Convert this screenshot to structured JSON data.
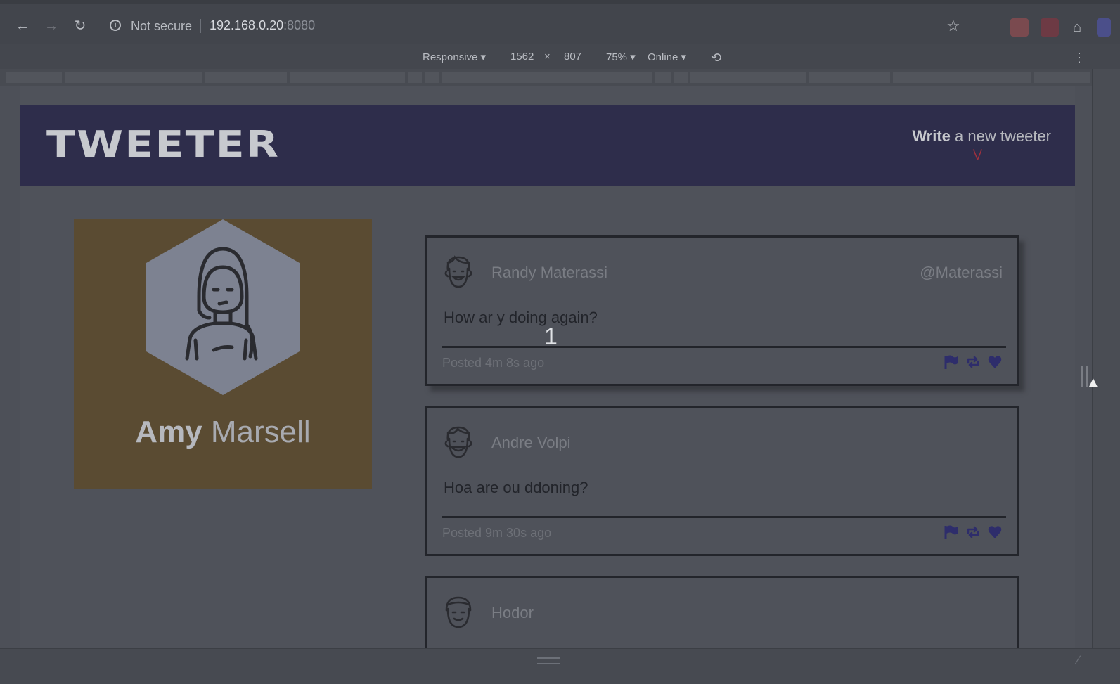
{
  "browser": {
    "security_label": "Not secure",
    "url_host": "192.168.0.20",
    "url_port": ":8080"
  },
  "devtools": {
    "device": "Responsive",
    "width": "1562",
    "times": "×",
    "height": "807",
    "zoom": "75%",
    "network": "Online"
  },
  "header": {
    "logo": "TWEETER",
    "compose_strong": "Write",
    "compose_rest": " a new tweeter"
  },
  "profile": {
    "first_name": "Amy",
    "last_name": " Marsell",
    "background": "#5a4b32"
  },
  "tweets": [
    {
      "name": "Randy Materassi",
      "handle": "@Materassi",
      "body": "How ar y doing again?",
      "posted": "Posted 4m 8s ago"
    },
    {
      "name": "Andre Volpi",
      "handle": "",
      "body": "Hoa are ou ddoning?",
      "posted": "Posted 9m 30s ago"
    },
    {
      "name": "Hodor",
      "handle": "",
      "body": "",
      "posted": ""
    }
  ],
  "overlay_counter": "1",
  "colors": {
    "header_bg": "#2e2d4b",
    "action_icons": "#2e2d6b",
    "page_bg": "#4f525a"
  }
}
